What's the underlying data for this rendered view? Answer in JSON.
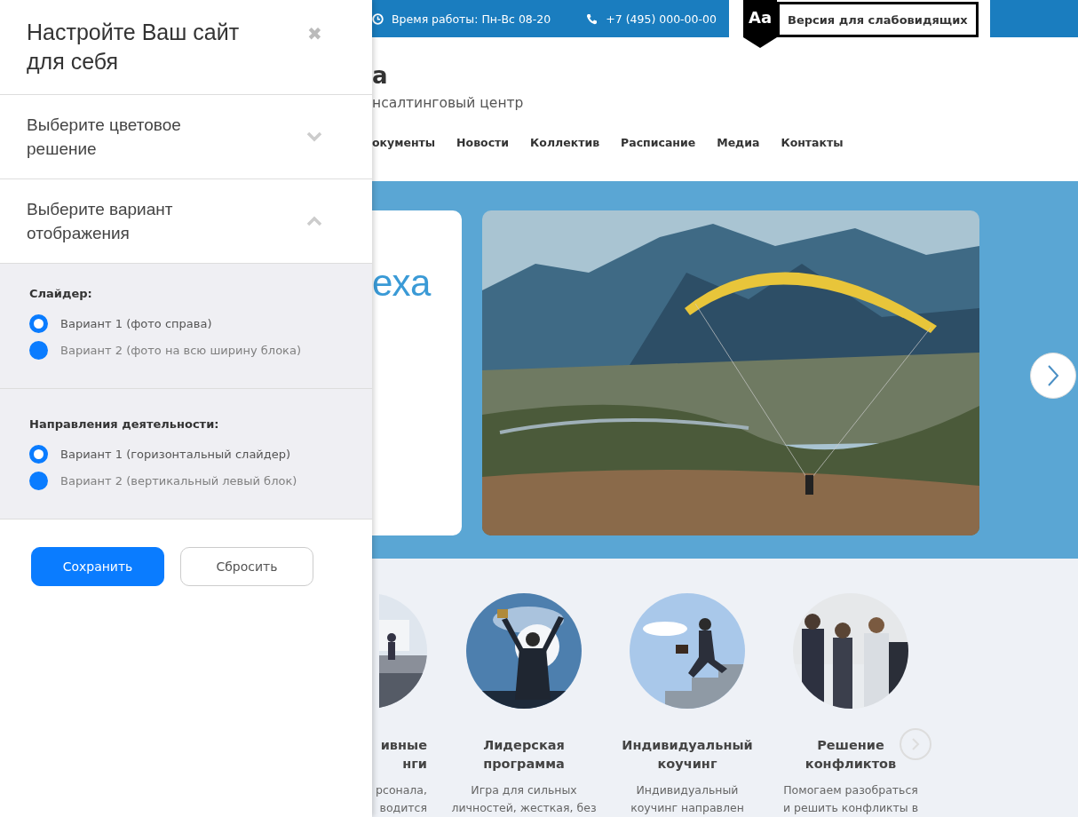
{
  "panel": {
    "title": "Настройте Ваш сайт для себя",
    "close": "✖",
    "sections": [
      {
        "title": "Выберите цветовое решение",
        "expanded": false
      },
      {
        "title": "Выберите вариант отображения",
        "expanded": true,
        "groups": [
          {
            "label": "Слайдер:",
            "options": [
              {
                "label": "Вариант 1 (фото справа)",
                "selected": true
              },
              {
                "label": "Вариант 2 (фото на всю ширину блока)",
                "selected": false
              }
            ]
          },
          {
            "label": "Направления деятельности:",
            "options": [
              {
                "label": "Вариант 1 (горизонтальный слайдер)",
                "selected": true
              },
              {
                "label": "Вариант 2 (вертикальный левый блок)",
                "selected": false
              }
            ]
          }
        ]
      }
    ],
    "buttons": [
      {
        "label": "Сохранить",
        "kind": "primary"
      },
      {
        "label": "Сбросить",
        "kind": "secondary"
      }
    ]
  },
  "site": {
    "topbar": {
      "hours": "Время работы: Пн-Вс 08-20",
      "phone": "+7 (495) 000-00-00",
      "accessibility": {
        "badge": "Aa",
        "label": "Версия для слабовидящих"
      }
    },
    "logo": "а",
    "tagline": "нсалтинговый центр",
    "nav": [
      {
        "label": "окументы"
      },
      {
        "label": "Новости"
      },
      {
        "label": "Коллектив"
      },
      {
        "label": "Расписание"
      },
      {
        "label": "Медиа"
      },
      {
        "label": "Контакты"
      }
    ],
    "slider": {
      "heading": "еха"
    },
    "services": [
      {
        "kind": "partial",
        "title_lines": [
          "ивные",
          "нги"
        ],
        "text_lines": [
          "рсонала,",
          "водится"
        ]
      },
      {
        "kind": "full",
        "title_lines": [
          "Лидерская",
          "программа"
        ],
        "text_lines": [
          "Игра для сильных",
          "личностей, жесткая, без"
        ]
      },
      {
        "kind": "full",
        "title_lines": [
          "Индивидуальный",
          "коучинг"
        ],
        "text_lines": [
          "Индивидуальный",
          "коучинг направлен"
        ]
      },
      {
        "kind": "full",
        "title_lines": [
          "Решение",
          "конфликтов"
        ],
        "text_lines": [
          "Помогаем разобраться",
          "и решить конфликты в"
        ]
      }
    ]
  }
}
